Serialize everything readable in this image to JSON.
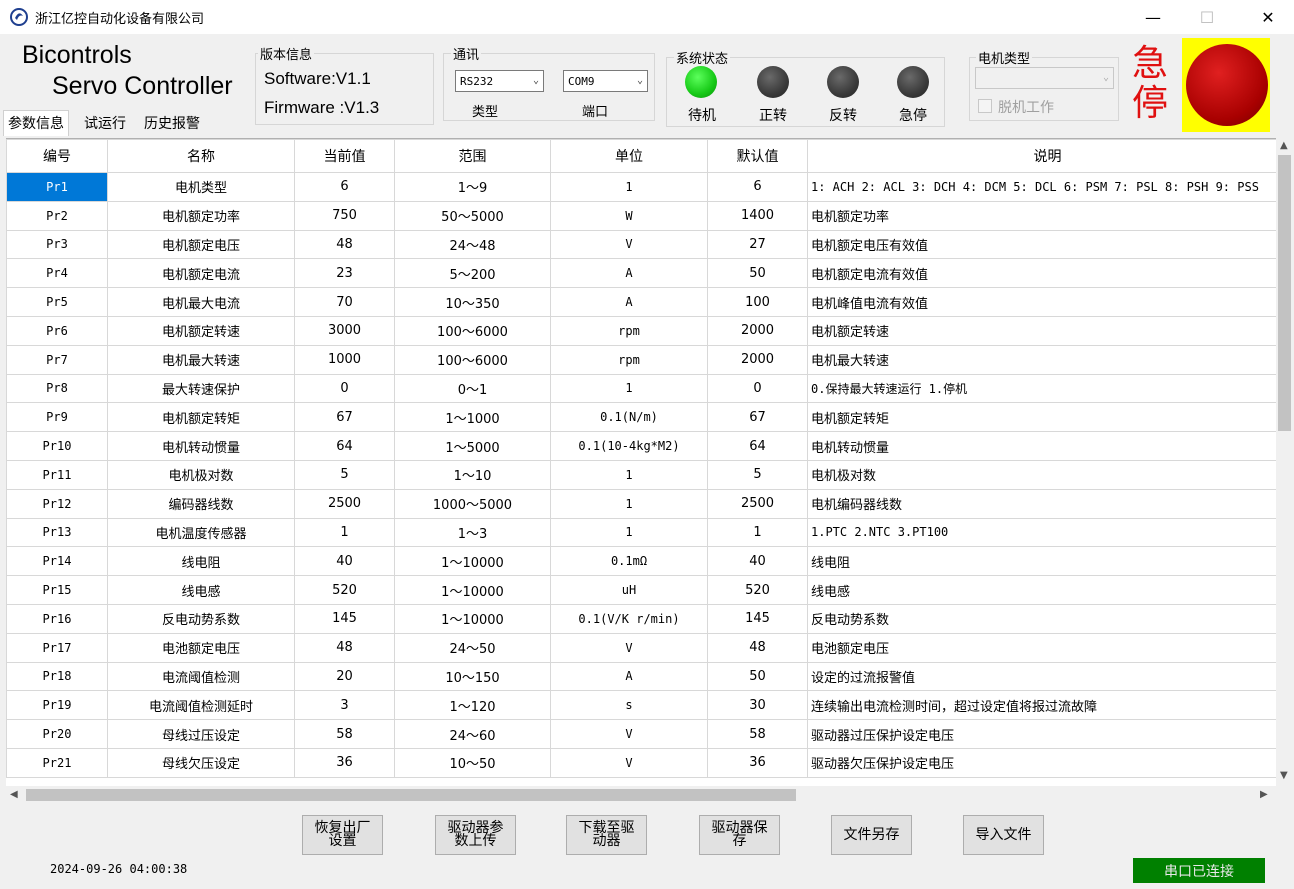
{
  "window": {
    "title": "浙江亿控自动化设备有限公司",
    "minimize": "—",
    "maximize": "☐",
    "close": "✕"
  },
  "brand": {
    "line1": "Bicontrols",
    "line2": "Servo Controller"
  },
  "version": {
    "title": "版本信息",
    "software": "Software:V1.1",
    "firmware": "Firmware :V1.3"
  },
  "comm": {
    "title": "通讯",
    "type_value": "RS232",
    "port_value": "COM9",
    "type_label": "类型",
    "port_label": "端口"
  },
  "system_status": {
    "title": "系统状态",
    "indicators": [
      {
        "label": "待机",
        "state": "on",
        "color": "#16c916"
      },
      {
        "label": "正转",
        "state": "off",
        "color": "#3a3a3a"
      },
      {
        "label": "反转",
        "state": "off",
        "color": "#3a3a3a"
      },
      {
        "label": "急停",
        "state": "off",
        "color": "#3a3a3a"
      }
    ]
  },
  "motor_type": {
    "title": "电机类型",
    "value": "",
    "offline_label": "脱机工作",
    "offline_checked": false
  },
  "estop": {
    "label": "急停",
    "text_color": "#e01010",
    "button_color": "#a80000",
    "background": "#ffff00"
  },
  "tabs": [
    {
      "label": "参数信息",
      "active": true
    },
    {
      "label": "试运行",
      "active": false
    },
    {
      "label": "历史报警",
      "active": false
    }
  ],
  "table": {
    "columns": [
      "编号",
      "名称",
      "当前值",
      "范围",
      "单位",
      "默认值",
      "说明"
    ],
    "rows": [
      [
        "Pr1",
        "电机类型",
        "6",
        "1～9",
        "1",
        "6",
        "1: ACH 2: ACL 3: DCH 4: DCM 5: DCL 6: PSM 7: PSL 8: PSH 9: PSS"
      ],
      [
        "Pr2",
        "电机额定功率",
        "750",
        "50～5000",
        "W",
        "1400",
        "电机额定功率"
      ],
      [
        "Pr3",
        "电机额定电压",
        "48",
        "24～48",
        "V",
        "27",
        "电机额定电压有效值"
      ],
      [
        "Pr4",
        "电机额定电流",
        "23",
        "5～200",
        "A",
        "50",
        "电机额定电流有效值"
      ],
      [
        "Pr5",
        "电机最大电流",
        "70",
        "10～350",
        "A",
        "100",
        "电机峰值电流有效值"
      ],
      [
        "Pr6",
        "电机额定转速",
        "3000",
        "100～6000",
        "rpm",
        "2000",
        "电机额定转速"
      ],
      [
        "Pr7",
        "电机最大转速",
        "1000",
        "100～6000",
        "rpm",
        "2000",
        "电机最大转速"
      ],
      [
        "Pr8",
        "最大转速保护",
        "0",
        "0～1",
        "1",
        "0",
        "0.保持最大转速运行 1.停机"
      ],
      [
        "Pr9",
        "电机额定转矩",
        "67",
        "1～1000",
        "0.1(N/m)",
        "67",
        "电机额定转矩"
      ],
      [
        "Pr10",
        "电机转动惯量",
        "64",
        "1～5000",
        "0.1(10-4kg*M2)",
        "64",
        "电机转动惯量"
      ],
      [
        "Pr11",
        "电机极对数",
        "5",
        "1～10",
        "1",
        "5",
        "电机极对数"
      ],
      [
        "Pr12",
        "编码器线数",
        "2500",
        "1000～5000",
        "1",
        "2500",
        "电机编码器线数"
      ],
      [
        "Pr13",
        "电机温度传感器",
        "1",
        "1～3",
        "1",
        "1",
        "1.PTC 2.NTC 3.PT100"
      ],
      [
        "Pr14",
        "线电阻",
        "40",
        "1～10000",
        "0.1mΩ",
        "40",
        "线电阻"
      ],
      [
        "Pr15",
        "线电感",
        "520",
        "1～10000",
        "uH",
        "520",
        "线电感"
      ],
      [
        "Pr16",
        "反电动势系数",
        "145",
        "1～10000",
        "0.1(V/K r/min)",
        "145",
        "反电动势系数"
      ],
      [
        "Pr17",
        "电池额定电压",
        "48",
        "24～50",
        "V",
        "48",
        "电池额定电压"
      ],
      [
        "Pr18",
        "电流阈值检测",
        "20",
        "10～150",
        "A",
        "50",
        "设定的过流报警值"
      ],
      [
        "Pr19",
        "电流阈值检测延时",
        "3",
        "1～120",
        "s",
        "30",
        "连续输出电流检测时间，超过设定值将报过流故障"
      ],
      [
        "Pr20",
        "母线过压设定",
        "58",
        "24～60",
        "V",
        "58",
        "驱动器过压保护设定电压"
      ],
      [
        "Pr21",
        "母线欠压设定",
        "36",
        "10～50",
        "V",
        "36",
        "驱动器欠压保护设定电压"
      ]
    ],
    "selected_row": 0
  },
  "buttons": {
    "restore": [
      "恢复出厂",
      "设置"
    ],
    "upload": [
      "驱动器参",
      "数上传"
    ],
    "download": [
      "下载至驱",
      "动器"
    ],
    "save_driver": [
      "驱动器保",
      "存"
    ],
    "save_as": [
      "文件另存"
    ],
    "import": [
      "导入文件"
    ]
  },
  "statusbar": {
    "timestamp": "2024-09-26 04:00:38",
    "connection": "串口已连接",
    "connection_color": "#008000"
  }
}
